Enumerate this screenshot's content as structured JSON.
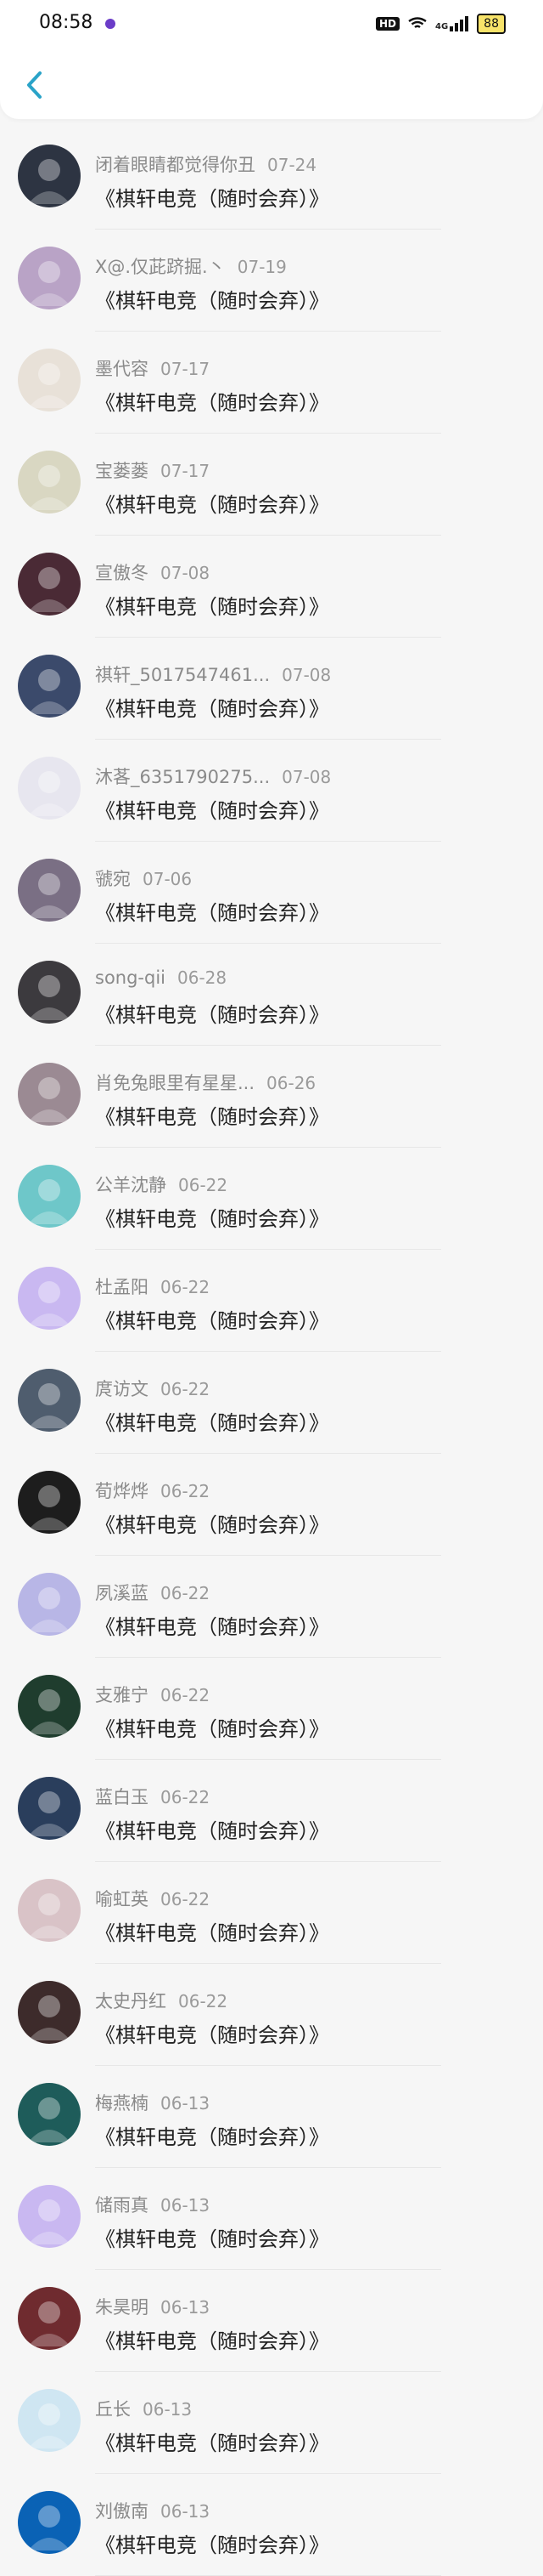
{
  "status_bar": {
    "time": "08:58",
    "badge": "HD",
    "signal": "4G",
    "battery": "88"
  },
  "header": {
    "back_icon": "chevron-left-icon",
    "back_color": "#2aa3c8"
  },
  "messages": [
    {
      "name": "闭着眼睛都觉得你丑",
      "date": "07-24",
      "text": "《棋轩电竞（随时会弃）》",
      "avatar_color": "#2d3442"
    },
    {
      "name": "X@.仅茈跻掘.丶",
      "date": "07-19",
      "text": "《棋轩电竞（随时会弃）》",
      "avatar_color": "#b9a3c6"
    },
    {
      "name": "墨代容",
      "date": "07-17",
      "text": "《棋轩电竞（随时会弃）》",
      "avatar_color": "#e8e1d8"
    },
    {
      "name": "宝蒌蒌",
      "date": "07-17",
      "text": "《棋轩电竞（随时会弃）》",
      "avatar_color": "#d9d7c2"
    },
    {
      "name": "宣傲冬",
      "date": "07-08",
      "text": "《棋轩电竞（随时会弃）》",
      "avatar_color": "#4a2a35"
    },
    {
      "name": "祺轩_5017547461...",
      "date": "07-08",
      "text": "《棋轩电竞（随时会弃）》",
      "avatar_color": "#3b4a6b"
    },
    {
      "name": "沐茖_6351790275...",
      "date": "07-08",
      "text": "《棋轩电竞（随时会弃）》",
      "avatar_color": "#e7e6ef"
    },
    {
      "name": "虢宛",
      "date": "07-06",
      "text": "《棋轩电竞（随时会弃）》",
      "avatar_color": "#7a6f84"
    },
    {
      "name": "song-qii",
      "date": "06-28",
      "text": "《棋轩电竞（随时会弃）》",
      "avatar_color": "#3c3a3e"
    },
    {
      "name": "肖免兔眼里有星星...",
      "date": "06-26",
      "text": "《棋轩电竞（随时会弃）》",
      "avatar_color": "#9b8a93"
    },
    {
      "name": "公羊沈静",
      "date": "06-22",
      "text": "《棋轩电竞（随时会弃）》",
      "avatar_color": "#6ec7c9"
    },
    {
      "name": "杜孟阳",
      "date": "06-22",
      "text": "《棋轩电竞（随时会弃）》",
      "avatar_color": "#c9b8f1"
    },
    {
      "name": "庹访文",
      "date": "06-22",
      "text": "《棋轩电竞（随时会弃）》",
      "avatar_color": "#4f5d6e"
    },
    {
      "name": "荀烨烨",
      "date": "06-22",
      "text": "《棋轩电竞（随时会弃）》",
      "avatar_color": "#1d1d1d"
    },
    {
      "name": "夙溪蓝",
      "date": "06-22",
      "text": "《棋轩电竞（随时会弃）》",
      "avatar_color": "#b8b6e6"
    },
    {
      "name": "支雅宁",
      "date": "06-22",
      "text": "《棋轩电竞（随时会弃）》",
      "avatar_color": "#1f3d2e"
    },
    {
      "name": "蓝白玉",
      "date": "06-22",
      "text": "《棋轩电竞（随时会弃）》",
      "avatar_color": "#2a3e5c"
    },
    {
      "name": "喻虹英",
      "date": "06-22",
      "text": "《棋轩电竞（随时会弃）》",
      "avatar_color": "#d9c3c7"
    },
    {
      "name": "太史丹红",
      "date": "06-22",
      "text": "《棋轩电竞（随时会弃）》",
      "avatar_color": "#3d2b2b"
    },
    {
      "name": "梅燕楠",
      "date": "06-13",
      "text": "《棋轩电竞（随时会弃）》",
      "avatar_color": "#1e5c5a"
    },
    {
      "name": "储雨真",
      "date": "06-13",
      "text": "《棋轩电竞（随时会弃）》",
      "avatar_color": "#c9b8f1"
    },
    {
      "name": "朱昊明",
      "date": "06-13",
      "text": "《棋轩电竞（随时会弃）》",
      "avatar_color": "#6f2b2f"
    },
    {
      "name": "丘长",
      "date": "06-13",
      "text": "《棋轩电竞（随时会弃）》",
      "avatar_color": "#cfe6f2"
    },
    {
      "name": "刘傲南",
      "date": "06-13",
      "text": "《棋轩电竞（随时会弃）》",
      "avatar_color": "#0a62b5"
    }
  ]
}
